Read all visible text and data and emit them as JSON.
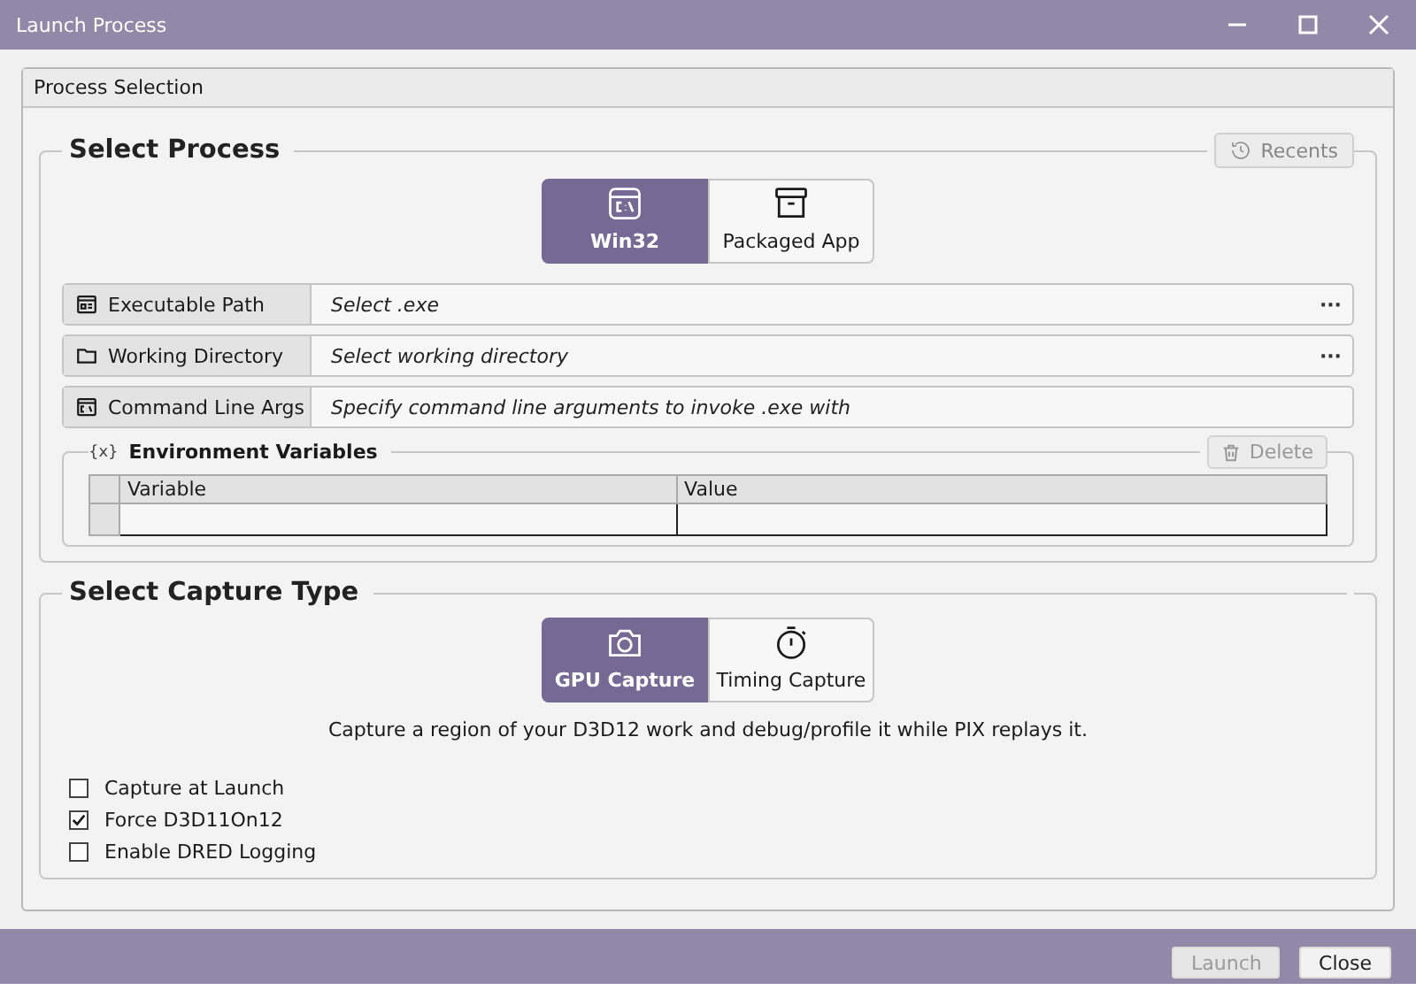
{
  "window": {
    "title": "Launch Process"
  },
  "process_selection": {
    "header": "Process Selection",
    "select_process": {
      "title": "Select Process",
      "recents_button": "Recents",
      "targets": [
        {
          "kind": "win32",
          "label": "Win32",
          "selected": true
        },
        {
          "kind": "package",
          "label": "Packaged App",
          "selected": false
        }
      ],
      "fields": [
        {
          "kind": "exe",
          "label": "Executable Path",
          "placeholder": "Select .exe",
          "browse": "···"
        },
        {
          "kind": "folder",
          "label": "Working Directory",
          "placeholder": "Select working directory",
          "browse": "···"
        },
        {
          "kind": "args",
          "label": "Command Line Args",
          "placeholder": "Specify command line arguments to invoke .exe with"
        }
      ],
      "environment": {
        "icon_text": "{x}",
        "title": "Environment Variables",
        "delete_button": {
          "label": "Delete",
          "disabled": true
        },
        "columns": [
          "Variable",
          "Value"
        ]
      }
    },
    "select_capture": {
      "title": "Select Capture Type",
      "types": [
        {
          "kind": "gpu",
          "label": "GPU Capture",
          "selected": true
        },
        {
          "kind": "timing",
          "label": "Timing Capture",
          "selected": false
        }
      ],
      "description": "Capture a region of your D3D12 work and debug/profile it while PIX replays it.",
      "options": [
        {
          "label": "Capture at Launch",
          "checked": false
        },
        {
          "label": "Force D3D11On12",
          "checked": true
        },
        {
          "label": "Enable DRED Logging",
          "checked": false
        }
      ]
    }
  },
  "footer": {
    "buttons": [
      {
        "label": "Launch",
        "disabled": true
      },
      {
        "label": "Close",
        "disabled": false
      }
    ]
  }
}
